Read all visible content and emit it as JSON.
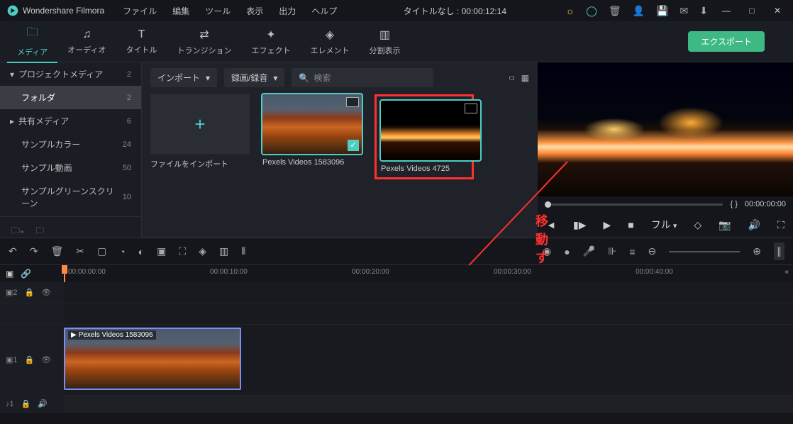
{
  "titlebar": {
    "app_name": "Wondershare Filmora",
    "menus": [
      "ファイル",
      "編集",
      "ツール",
      "表示",
      "出力",
      "ヘルプ"
    ],
    "center": "タイトルなし : 00:00:12:14"
  },
  "main_tabs": [
    {
      "label": "メディア",
      "icon": "folder-icon"
    },
    {
      "label": "オーディオ",
      "icon": "music-icon"
    },
    {
      "label": "タイトル",
      "icon": "text-icon"
    },
    {
      "label": "トランジション",
      "icon": "transition-icon"
    },
    {
      "label": "エフェクト",
      "icon": "sparkle-icon"
    },
    {
      "label": "エレメント",
      "icon": "element-icon"
    },
    {
      "label": "分割表示",
      "icon": "split-icon"
    }
  ],
  "export_label": "エクスポート",
  "sidebar": {
    "items": [
      {
        "label": "プロジェクトメディア",
        "count": "2",
        "head": true
      },
      {
        "label": "フォルダ",
        "count": "2",
        "active": true,
        "sub": true
      },
      {
        "label": "共有メディア",
        "count": "6",
        "head": true
      },
      {
        "label": "サンプルカラー",
        "count": "24",
        "sub": true
      },
      {
        "label": "サンプル動画",
        "count": "50",
        "sub": true
      },
      {
        "label": "サンプルグリーンスクリーン",
        "count": "10",
        "sub": true
      }
    ]
  },
  "media_toolbar": {
    "import_label": "インポート",
    "record_label": "録画/録音",
    "search_placeholder": "検索"
  },
  "media_items": [
    {
      "label": "ファイルをインポート",
      "is_add": true
    },
    {
      "label": "Pexels Videos 1583096",
      "checked": true
    },
    {
      "label": "Pexels Videos 4725",
      "highlight": true
    }
  ],
  "annotation": {
    "text": "移動する"
  },
  "preview": {
    "brackets": "{  }",
    "time": "00:00:00:00",
    "full_label": "フル"
  },
  "timeline": {
    "ticks": [
      "00:00:00:00",
      "00:00:10:00",
      "00:00:20:00",
      "00:00:30:00",
      "00:00:40:00"
    ],
    "clip_label": "Pexels Videos 1583096"
  }
}
